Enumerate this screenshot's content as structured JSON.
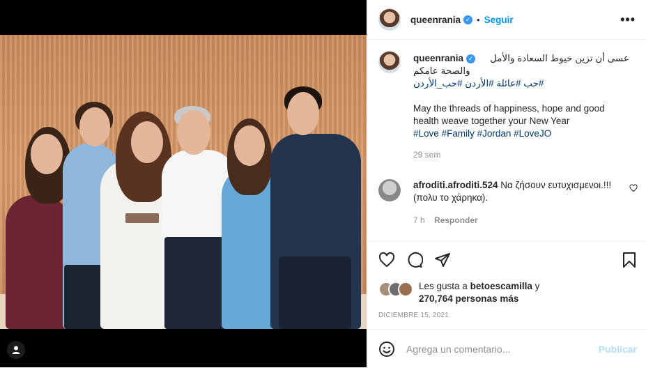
{
  "post": {
    "username": "queenrania",
    "verified_glyph": "✓",
    "separator": "•",
    "follow_label": "Seguir",
    "more_glyph": "•••",
    "caption_arabic_line1": "عسى أن تزين خيوط السعادة والأمل",
    "caption_arabic_line2": "والصحة عامكم",
    "caption_hashtags_arabic": "#حب #عائلة #الأردن #حب_الأردن",
    "caption_english_line1": "May the threads of happiness, hope and good",
    "caption_english_line2": "health weave together your New Year",
    "caption_hashtags": [
      "#Love",
      "#Family",
      "#Jordan",
      "#LoveJO"
    ],
    "caption_age": "29 sem"
  },
  "comment": {
    "username": "afroditi.afroditi.524",
    "text_line1": "Να ζήσουν ευτυχισμενοι.!!!",
    "text_line2": "(πολυ το χάρηκα).",
    "age": "7 h",
    "reply_label": "Responder"
  },
  "likes": {
    "prefix": "Les gusta a",
    "user": "betoescamilla",
    "conjunction": "y",
    "others": "270,764 personas más"
  },
  "date_label": "DICIEMBRE 15, 2021",
  "add_comment": {
    "placeholder": "Agrega un comentario...",
    "publish_label": "Publicar"
  },
  "icons": {
    "verified": "verified-badge-icon",
    "more": "more-options-icon",
    "like": "heart-icon",
    "comment": "comment-icon",
    "share": "paper-plane-icon",
    "save": "bookmark-icon",
    "emoji": "emoji-icon",
    "tag": "user-tag-icon"
  },
  "colors": {
    "link_blue": "#0095f6",
    "hashtag": "#00376b",
    "muted": "#8e8e8e",
    "publish_disabled": "#b2dffc"
  }
}
